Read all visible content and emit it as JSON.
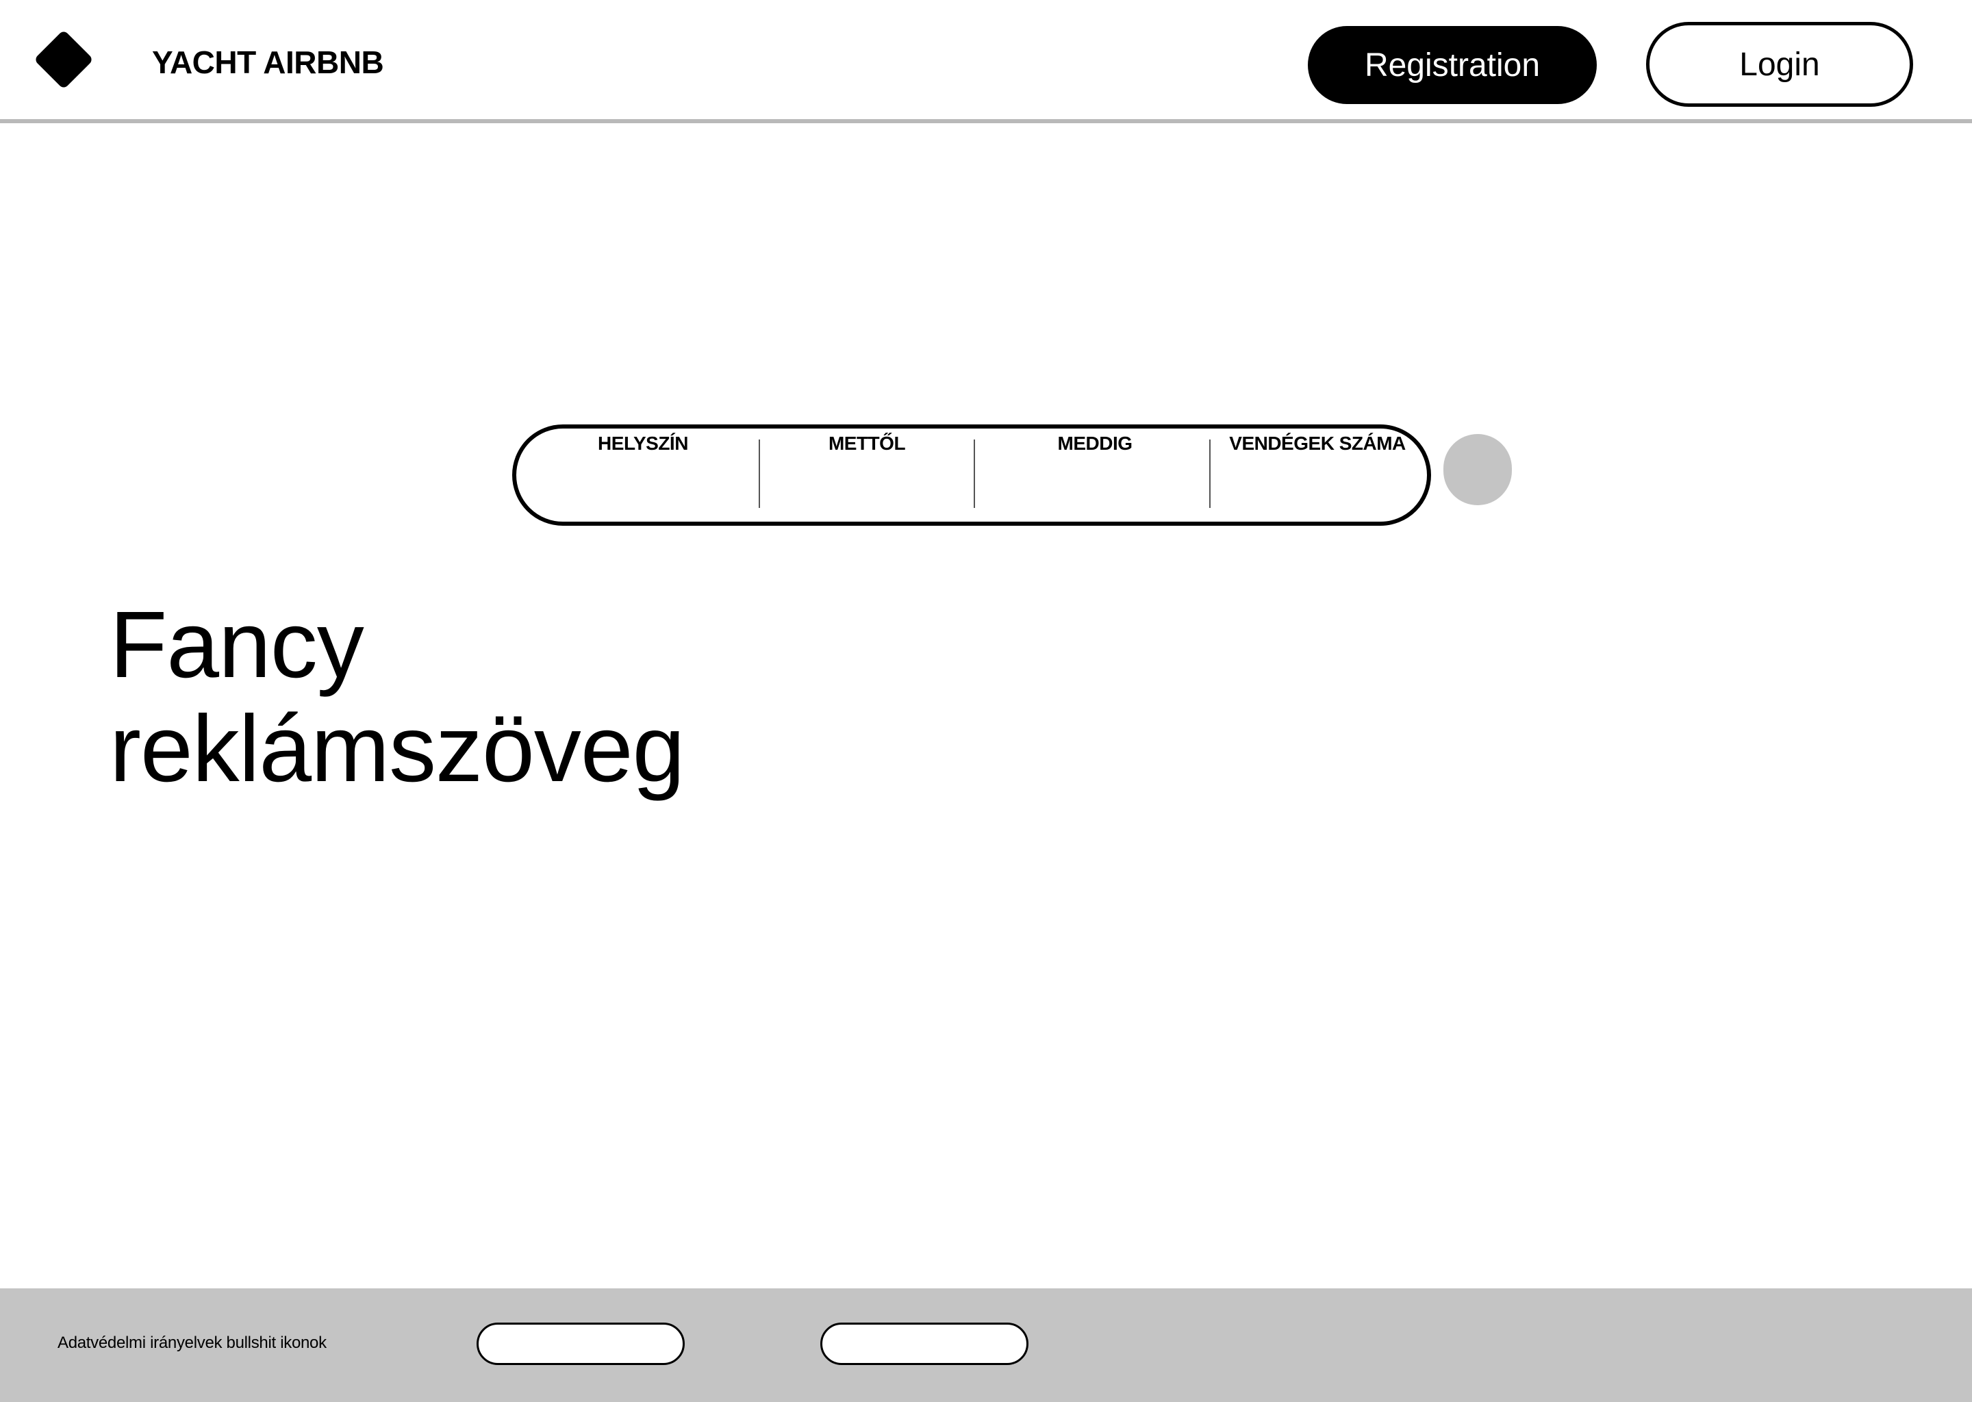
{
  "header": {
    "brand": "YACHT AIRBNB",
    "logo_icon": "diamond-logo-icon",
    "registration_label": "Registration",
    "login_label": "Login"
  },
  "search": {
    "fields": [
      {
        "label": "HELYSZÍN"
      },
      {
        "label": "METTŐL"
      },
      {
        "label": "MEDDIG"
      },
      {
        "label": "VENDÉGEK SZÁMA"
      }
    ],
    "button_color": "#c4c4c4"
  },
  "hero": {
    "line1": "Fancy",
    "line2": "reklámszöveg"
  },
  "footer": {
    "text": "Adatvédelmi irányelvek bullshit ikonok",
    "background": "#c4c4c4"
  }
}
